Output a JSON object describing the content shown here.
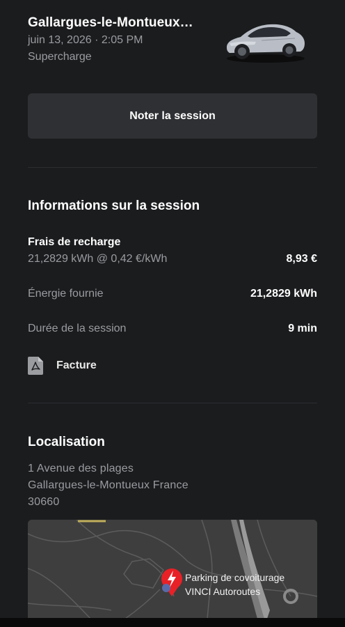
{
  "session": {
    "title": "Gallargues-le-Montueux…",
    "date": "juin 13, 2026 · 2:05 PM",
    "type": "Supercharge",
    "car_icon": "car-image-icon"
  },
  "actions": {
    "rate_label": "Noter la session"
  },
  "info": {
    "heading": "Informations sur la session",
    "charge_fees_label": "Frais de recharge",
    "charge_fees_detail": "21,2829 kWh @ 0,42 €/kWh",
    "charge_fees_value": "8,93 €",
    "energy_label": "Énergie fournie",
    "energy_value": "21,2829 kWh",
    "duration_label": "Durée de la session",
    "duration_value": "9 min",
    "invoice_label": "Facture",
    "invoice_icon": "pdf-icon"
  },
  "location": {
    "heading": "Localisation",
    "address_line1": "1 Avenue des plages",
    "address_line2": "Gallargues-le-Montueux France",
    "postal_code": "30660",
    "map_label_line1": "Parking de covoiturage",
    "map_label_line2": "VINCI Autoroutes",
    "pin_icon": "supercharger-pin-icon"
  },
  "colors": {
    "background": "#1b1c1e",
    "button": "#2f3033",
    "muted_text": "#9a9ca0",
    "pin": "#e82127"
  }
}
